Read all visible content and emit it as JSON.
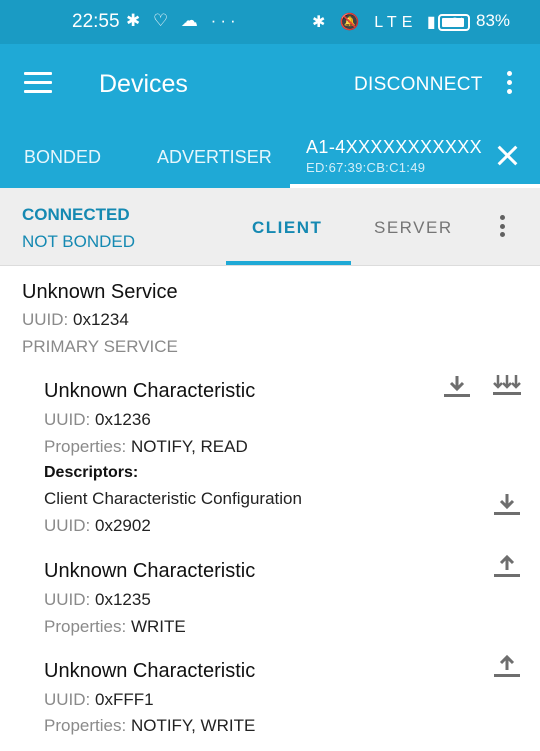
{
  "status_bar": {
    "time": "22:55",
    "left_icons": "✱ ♡ ☁ ···",
    "right_icons": "✱ 🔕 LTE ▮ ≋",
    "battery_percent": "83%"
  },
  "app_bar": {
    "title": "Devices",
    "disconnect_label": "DISCONNECT"
  },
  "top_tabs": {
    "bonded": "BONDED",
    "advertiser": "ADVERTISER",
    "device_name": "A1-4XXXXXXXXXXX",
    "device_mac": "ED:67:39:CB:C1:49"
  },
  "connection": {
    "state": "CONNECTED",
    "bond": "NOT BONDED",
    "client_tab": "CLIENT",
    "server_tab": "SERVER"
  },
  "service": {
    "name": "Unknown Service",
    "uuid_label": "UUID:",
    "uuid": "0x1234",
    "type": "PRIMARY SERVICE"
  },
  "characteristics": [
    {
      "name": "Unknown Characteristic",
      "uuid_label": "UUID:",
      "uuid": "0x1236",
      "properties_label": "Properties:",
      "properties": "NOTIFY, READ",
      "descriptors_label": "Descriptors:",
      "descriptor_name": "Client Characteristic Configuration",
      "descriptor_uuid_label": "UUID:",
      "descriptor_uuid": "0x2902"
    },
    {
      "name": "Unknown Characteristic",
      "uuid_label": "UUID:",
      "uuid": "0x1235",
      "properties_label": "Properties:",
      "properties": "WRITE"
    },
    {
      "name": "Unknown Characteristic",
      "uuid_label": "UUID:",
      "uuid": "0xFFF1",
      "properties_label": "Properties:",
      "properties": "NOTIFY, WRITE"
    }
  ],
  "colors": {
    "status_bar": "#1a9bc4",
    "app_bar": "#1fa9d6",
    "accent": "#1589b2",
    "icon_grey": "#757575"
  }
}
